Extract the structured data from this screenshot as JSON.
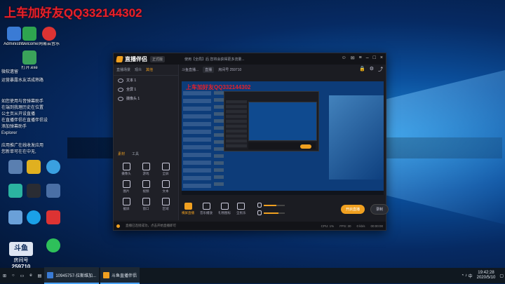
{
  "watermark": "上车加好友QQ332144302",
  "desktop": {
    "icons": [
      {
        "label": "Administr...",
        "color": "#3a7bd5"
      },
      {
        "label": "Welcome",
        "color": "#2ea44f"
      },
      {
        "label": "",
        "color": "#d33"
      },
      {
        "label": "",
        "color": "#3a7bd5"
      },
      {
        "label": "打开.exe",
        "color": "#3aa35a"
      },
      {
        "label": "网易云音乐",
        "color": "#d33"
      }
    ],
    "side_texts": [
      "微软遗留",
      "运营暴露水友活成熟路",
      "如您使用与音弹幕助手",
      "在端到我理历史在位置",
      "公主页从开设直播",
      "在直播伴侣在直播伴侣设",
      "添加弹幕助手",
      "Explorer",
      "应用推广在线收发应用",
      "您新单可在在中无,"
    ],
    "room": {
      "label": "房间号",
      "number": "259710"
    }
  },
  "taskbar": {
    "apps": [
      "10945757-拉斯维加...",
      "斗鱼直播伴侣"
    ],
    "time": "19:42:28",
    "date": "2020/5/10"
  },
  "app": {
    "title": "直播伴侣",
    "version": "正式版",
    "notice": "使用【全局】后 您将会获得更多流量...",
    "left_tabs": [
      "直播场景",
      "观众",
      "其他"
    ],
    "scenes": [
      "文本 1",
      "全屏 1",
      "摄像头 1"
    ],
    "tool_tabs": [
      "素材",
      "工具"
    ],
    "tools": [
      "摄像头",
      "游戏",
      "全屏",
      "图片",
      "视频",
      "文本",
      "截屏",
      "窗口",
      "区域"
    ],
    "main_head": {
      "name": "斗鱼直播...",
      "room_label": "房间号 259710",
      "pill": "直播"
    },
    "preview_watermark": "上车加好友QQ332144302",
    "footer_tools": [
      "横屏直播",
      "音乐播放",
      "礼物图标",
      "全民乐",
      "更多"
    ],
    "live_button": "开启直播",
    "record_button": "录制",
    "status": {
      "notice": "直播已连接成功，点击开始直播即可",
      "cpu": "CPU: 1%",
      "fps": "FPS: 30",
      "bitrate": "0 kb/s",
      "time": "00:00:00"
    }
  }
}
